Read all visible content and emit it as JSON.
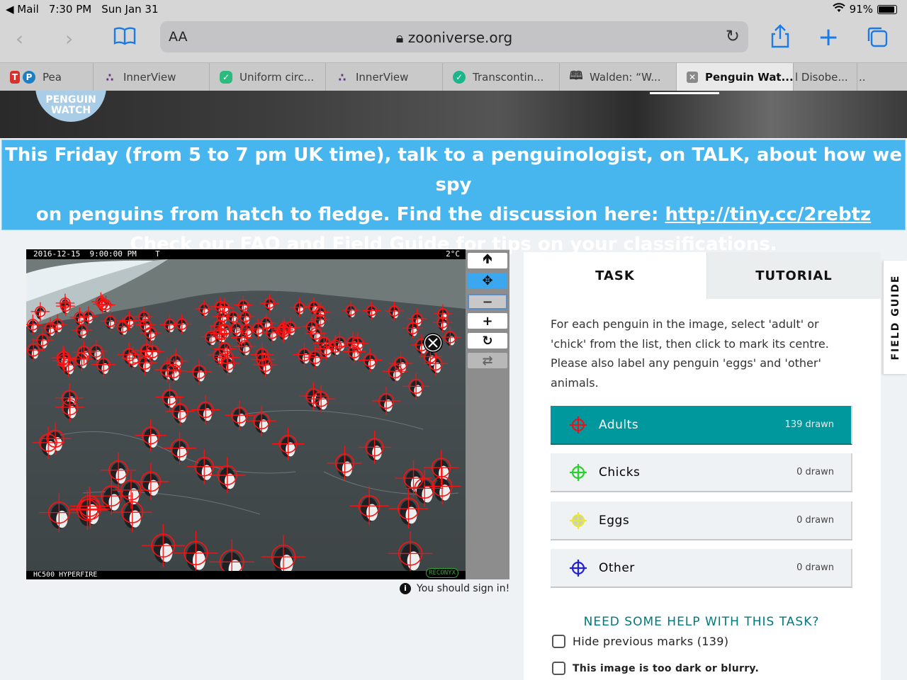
{
  "status": {
    "back_app": "◀ Mail",
    "time": "7:30 PM",
    "date": "Sun Jan 31",
    "battery": "91%"
  },
  "browser": {
    "aa_label": "AA",
    "url": "zooniverse.org"
  },
  "tabs": [
    {
      "label": "Pea",
      "icon": "pear-deck-icon"
    },
    {
      "label": "InnerView",
      "icon": "innerview-icon"
    },
    {
      "label": "Uniform circ...",
      "icon": "shield-icon"
    },
    {
      "label": "InnerView",
      "icon": "innerview-icon"
    },
    {
      "label": "Transcontin...",
      "icon": "check-badge-icon"
    },
    {
      "label": "Walden: “W...",
      "icon": "book-icon"
    },
    {
      "label": "Penguin Wat...",
      "icon": "close-icon"
    },
    {
      "label": "l Disobe...",
      "icon": ""
    },
    {
      "label": "..",
      "icon": ""
    }
  ],
  "site": {
    "logo_text_1": "PENGUIN",
    "logo_text_2": "WATCH"
  },
  "banner": {
    "line1": "This Friday (from 5 to 7 pm UK time), talk to a penguinologist, on TALK, about how we spy",
    "line2_pre": "on penguins from hatch to fledge. Find the discussion here: ",
    "line2_link": "http://tiny.cc/2rebtz",
    "line3_pre": "Check our ",
    "line3_link": "FAQ",
    "line3_post": " and Field Guide for tips on your classifications."
  },
  "camera": {
    "timestamp": "2016-12-15  9:00:00 PM    T",
    "temperature": "2°C",
    "model": "HC500  HYPERFIRE",
    "brand": "RECONYX"
  },
  "signin_text": "You should sign in!",
  "panel": {
    "tab_task": "TASK",
    "tab_tutorial": "TUTORIAL",
    "instructions": "For each penguin in the image, select 'adult' or 'chick' from the list, then click to mark its centre. Please also label any penguin 'eggs' and 'other' animals.",
    "choices": [
      {
        "label": "Adults",
        "count": "139 drawn",
        "color": "#e0181e"
      },
      {
        "label": "Chicks",
        "count": "0 drawn",
        "color": "#2bd12b"
      },
      {
        "label": "Eggs",
        "count": "0 drawn",
        "color": "#e8e83a"
      },
      {
        "label": "Other",
        "count": "0 drawn",
        "color": "#2020d8"
      }
    ],
    "help": "NEED SOME HELP WITH THIS TASK?",
    "hide_marks": "Hide previous marks (139)",
    "too_dark": "This image is too dark or blurry."
  },
  "field_guide": "FIELD GUIDE"
}
